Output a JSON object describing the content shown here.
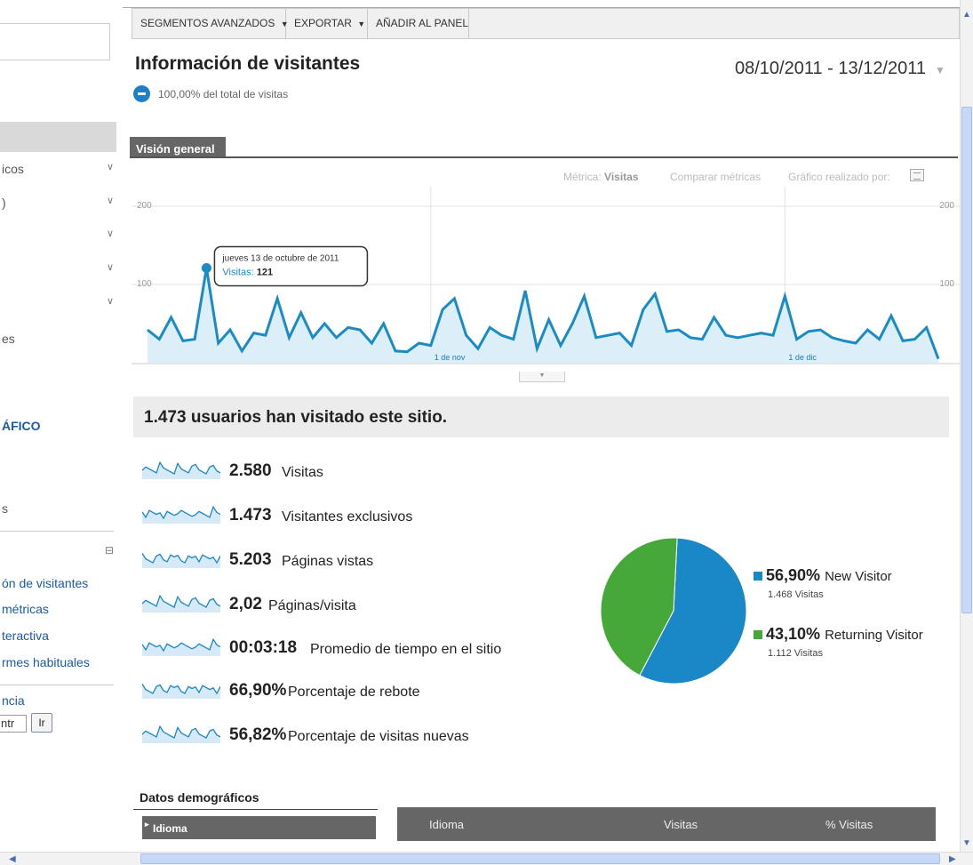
{
  "toolbar": {
    "segments_label": "SEGMENTOS AVANZADOS",
    "export_label": "EXPORTAR",
    "add_panel_label": "AÑADIR AL PANEL"
  },
  "header": {
    "title": "Información de visitantes",
    "percentage_text": "100,00% del total de visitas",
    "date_range": "08/10/2011 - 13/12/2011"
  },
  "sidebar": {
    "items": [
      {
        "label": "icos"
      },
      {
        "label": ")"
      },
      {
        "label": ""
      },
      {
        "label": ""
      },
      {
        "label": ""
      }
    ],
    "text_es": "es",
    "section_label": "ÁFICO",
    "text_s": "s",
    "links": [
      "ón de visitantes",
      "métricas",
      "teractiva",
      "rmes habituales"
    ],
    "bottom_label": "ncia",
    "input_value": "ntr",
    "go_button": "Ir"
  },
  "tabs": {
    "general": "Visión general"
  },
  "chart_options": {
    "metric_label": "Métrica:",
    "metric_value": "Visitas",
    "compare": "Comparar métricas",
    "graphed_by": "Gráfico realizado por:"
  },
  "chart_data": {
    "type": "area",
    "ylim": [
      0,
      200
    ],
    "y_ticks_left": [
      "200",
      "100"
    ],
    "y_ticks_right": [
      "200",
      "100"
    ],
    "x_labels": [
      "1 de nov",
      "1 de dic"
    ],
    "x_label_index": [
      24,
      54
    ],
    "values": [
      42,
      30,
      58,
      28,
      30,
      121,
      25,
      42,
      15,
      38,
      35,
      82,
      32,
      64,
      32,
      50,
      32,
      45,
      42,
      25,
      50,
      15,
      14,
      25,
      22,
      68,
      82,
      35,
      18,
      45,
      35,
      30,
      92,
      18,
      55,
      22,
      50,
      85,
      32,
      35,
      38,
      22,
      68,
      88,
      40,
      42,
      32,
      30,
      58,
      35,
      32,
      35,
      38,
      35,
      85,
      30,
      40,
      42,
      32,
      28,
      25,
      42,
      30,
      60,
      28,
      30,
      45,
      5
    ],
    "tooltip": {
      "index": 5,
      "date": "jueves 13 de octubre de 2011",
      "label": "Visitas:",
      "value": "121"
    },
    "color": "#1a8bc4",
    "fill": "#dceef8"
  },
  "summary": {
    "headline": "1.473 usuarios han visitado este sitio.",
    "metrics": [
      {
        "value": "2.580",
        "label": "Visitas"
      },
      {
        "value": "1.473",
        "label": "Visitantes exclusivos"
      },
      {
        "value": "5.203",
        "label": "Páginas vistas"
      },
      {
        "value": "2,02",
        "label": "Páginas/visita"
      },
      {
        "value": "00:03:18",
        "label": "Promedio de tiempo en el sitio"
      },
      {
        "value": "66,90%",
        "label": "Porcentaje de rebote"
      },
      {
        "value": "56,82%",
        "label": "Porcentaje de visitas nuevas"
      }
    ]
  },
  "pie": {
    "slices": [
      {
        "name": "New Visitor",
        "pct_text": "56,90%",
        "value": 56.9,
        "visits_text": "1.468 Visitas",
        "color": "#1a87c6"
      },
      {
        "name": "Returning Visitor",
        "pct_text": "43,10%",
        "value": 43.1,
        "visits_text": "1.112 Visitas",
        "color": "#47a83a"
      }
    ]
  },
  "demographics": {
    "title": "Datos demográficos",
    "tab": "Idioma",
    "columns": [
      "Idioma",
      "Visitas",
      "% Visitas"
    ]
  }
}
